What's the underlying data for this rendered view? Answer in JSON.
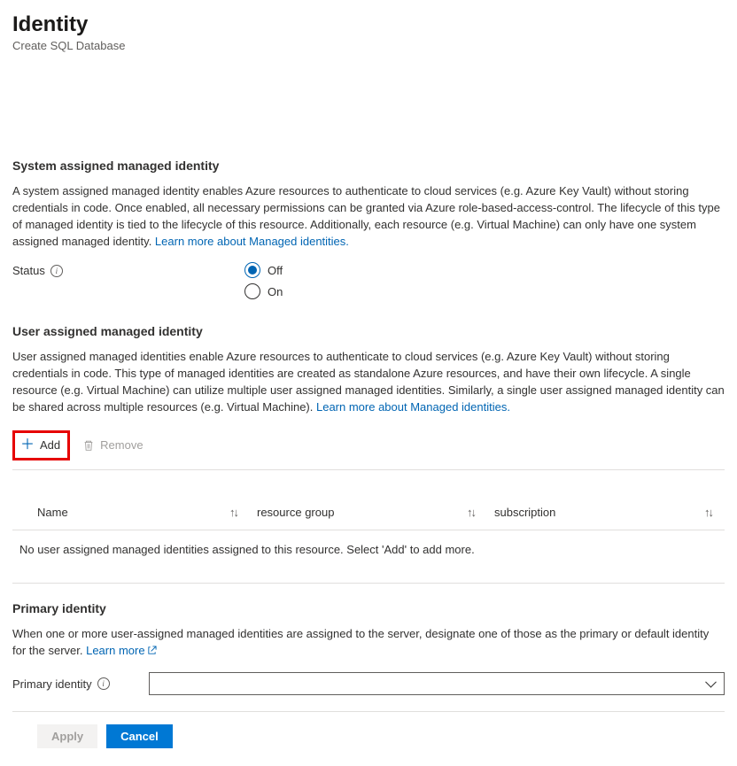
{
  "header": {
    "title": "Identity",
    "subtitle": "Create SQL Database"
  },
  "system_identity": {
    "heading": "System assigned managed identity",
    "description": "A system assigned managed identity enables Azure resources to authenticate to cloud services (e.g. Azure Key Vault) without storing credentials in code. Once enabled, all necessary permissions can be granted via Azure role-based-access-control. The lifecycle of this type of managed identity is tied to the lifecycle of this resource. Additionally, each resource (e.g. Virtual Machine) can only have one system assigned managed identity. ",
    "learn_more": "Learn more about Managed identities.",
    "status_label": "Status",
    "options": {
      "off": "Off",
      "on": "On"
    },
    "selected": "off"
  },
  "user_identity": {
    "heading": "User assigned managed identity",
    "description": "User assigned managed identities enable Azure resources to authenticate to cloud services (e.g. Azure Key Vault) without storing credentials in code. This type of managed identities are created as standalone Azure resources, and have their own lifecycle. A single resource (e.g. Virtual Machine) can utilize multiple user assigned managed identities. Similarly, a single user assigned managed identity can be shared across multiple resources (e.g. Virtual Machine). ",
    "learn_more": "Learn more about Managed identities.",
    "add_label": "Add",
    "remove_label": "Remove",
    "columns": {
      "name": "Name",
      "resource_group": "resource group",
      "subscription": "subscription"
    },
    "empty_message": "No user assigned managed identities assigned to this resource. Select 'Add' to add more."
  },
  "primary_identity": {
    "heading": "Primary identity",
    "description": "When one or more user-assigned managed identities are assigned to the server, designate one of those as the primary or default identity for the server. ",
    "learn_more": "Learn more",
    "field_label": "Primary identity",
    "selected_value": ""
  },
  "footer": {
    "apply": "Apply",
    "cancel": "Cancel"
  }
}
